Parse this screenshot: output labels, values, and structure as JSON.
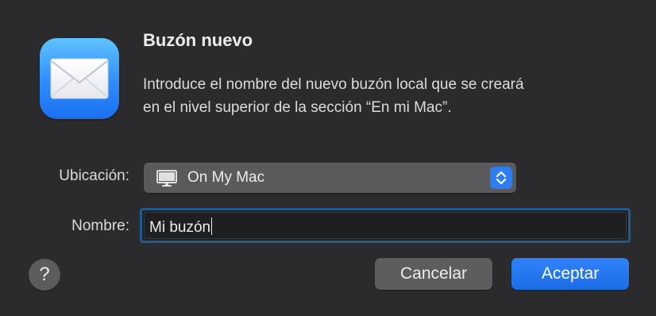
{
  "dialog": {
    "title": "Buzón nuevo",
    "message_line1": "Introduce el nombre del nuevo buzón local que se creará",
    "message_line2": "en el nivel superior de la sección “En mi Mac”.",
    "app_icon": "mail-envelope-icon"
  },
  "form": {
    "location_label": "Ubicación:",
    "location_value": "On My Mac",
    "location_icon": "computer-icon",
    "name_label": "Nombre:",
    "name_value": "Mi buzón"
  },
  "buttons": {
    "help_label": "?",
    "cancel_label": "Cancelar",
    "accept_label": "Aceptar"
  },
  "colors": {
    "background": "#2b2b2d",
    "accent": "#2f7df6",
    "focus_ring": "#1d5c8c"
  }
}
